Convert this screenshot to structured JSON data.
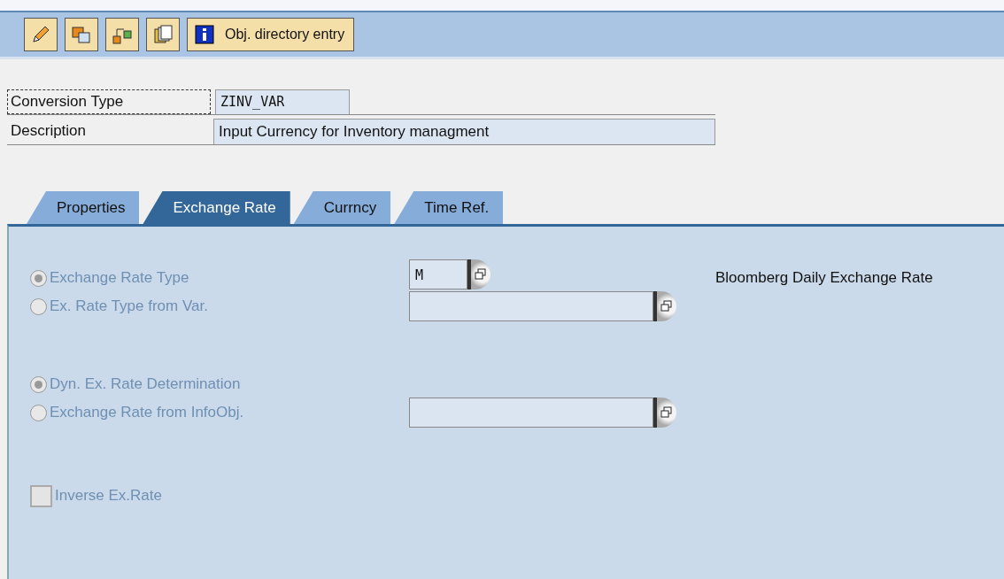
{
  "toolbar": {
    "info_button": {
      "label": "Obj. directory entry"
    }
  },
  "header": [
    {
      "label": "Conversion Type",
      "focused": true,
      "value": "ZINV_VAR",
      "kind": "short"
    },
    {
      "label": "Description",
      "focused": false,
      "value": "Input Currency for Inventory managment",
      "kind": "long"
    }
  ],
  "tabs": [
    {
      "label": "Properties",
      "selected": false
    },
    {
      "label": "Exchange Rate",
      "selected": true
    },
    {
      "label": "Currncy",
      "selected": false
    },
    {
      "label": "Time Ref.",
      "selected": false
    }
  ],
  "groups": [
    [
      {
        "kind": "radio",
        "label": "Exchange Rate Type",
        "selected": true,
        "disabled": true,
        "field": {
          "kind": "short",
          "value": "M"
        },
        "note": "Bloomberg Daily Exchange Rate"
      },
      {
        "kind": "radio",
        "label": "Ex. Rate Type from Var.",
        "selected": false,
        "disabled": true,
        "field": {
          "kind": "long"
        }
      }
    ],
    [
      {
        "kind": "radio",
        "label": "Dyn. Ex. Rate Determination",
        "selected": true,
        "disabled": true
      },
      {
        "kind": "radio",
        "label": "Exchange Rate from InfoObj.",
        "selected": false,
        "disabled": true,
        "field": {
          "kind": "long"
        }
      }
    ],
    [
      {
        "kind": "checkbox",
        "label": "Inverse Ex.Rate",
        "checked": false,
        "disabled": true
      }
    ]
  ]
}
